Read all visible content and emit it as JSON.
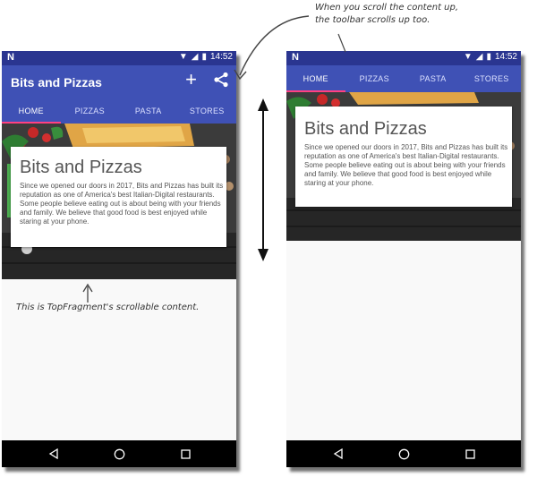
{
  "status": {
    "time": "14:52",
    "notification_icon": "N"
  },
  "app": {
    "title": "Bits and Pizzas",
    "plus_icon": "+"
  },
  "tabs": [
    "HOME",
    "PIZZAS",
    "PASTA",
    "STORES"
  ],
  "card": {
    "heading": "Bits and Pizzas",
    "body": "Since we opened our doors in 2017, Bits and Pizzas has built its reputation as one of America's best Italian-Digital restaurants. Some people believe eating out is about being with your friends and family. We believe that good food is best enjoyed while staring at your phone."
  },
  "annotations": {
    "scrollable": "This is TopFragment's scrollable content.",
    "toolbar_line1": "When you scroll the content up,",
    "toolbar_line2": "the toolbar scrolls up too."
  },
  "colors": {
    "primary": "#3f51b5",
    "primary_dark": "#2a3590",
    "accent": "#ff4081"
  }
}
